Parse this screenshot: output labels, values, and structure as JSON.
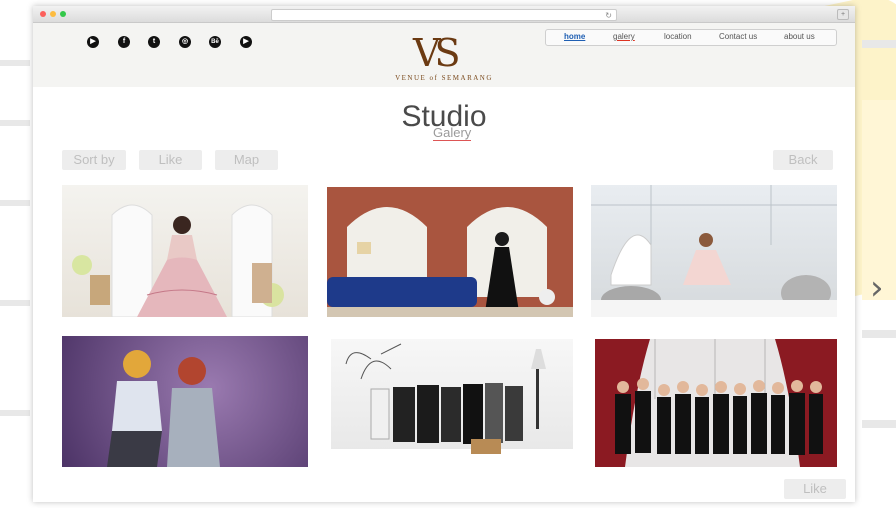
{
  "header": {
    "logo_text": "VS",
    "tagline": "VENUE of SEMARANG",
    "social_icons": [
      "youtube-icon",
      "facebook-icon",
      "twitter-icon",
      "instagram-icon",
      "behance-icon",
      "vimeo-icon"
    ],
    "social_glyphs": [
      "▶",
      "f",
      "t",
      "◎",
      "Bē",
      "▶"
    ]
  },
  "nav": {
    "items": [
      "home",
      "galery",
      "location",
      "Contact us",
      "about us"
    ]
  },
  "main": {
    "title": "Studio",
    "subtitle": "Galery",
    "buttons": {
      "sort_by": "Sort by",
      "like": "Like",
      "map": "Map",
      "back": "Back",
      "like_bottom": "Like"
    }
  },
  "gallery": {
    "photos": [
      "pink-gown-photo",
      "black-gown-brick-photo",
      "white-room-photo",
      "two-women-purple-photo",
      "group-white-set-photo",
      "group-red-curtain-photo"
    ]
  },
  "colors": {
    "nav_active": "#1f5fb3",
    "logo": "#6b3a12",
    "accent_underline": "#d33322"
  }
}
